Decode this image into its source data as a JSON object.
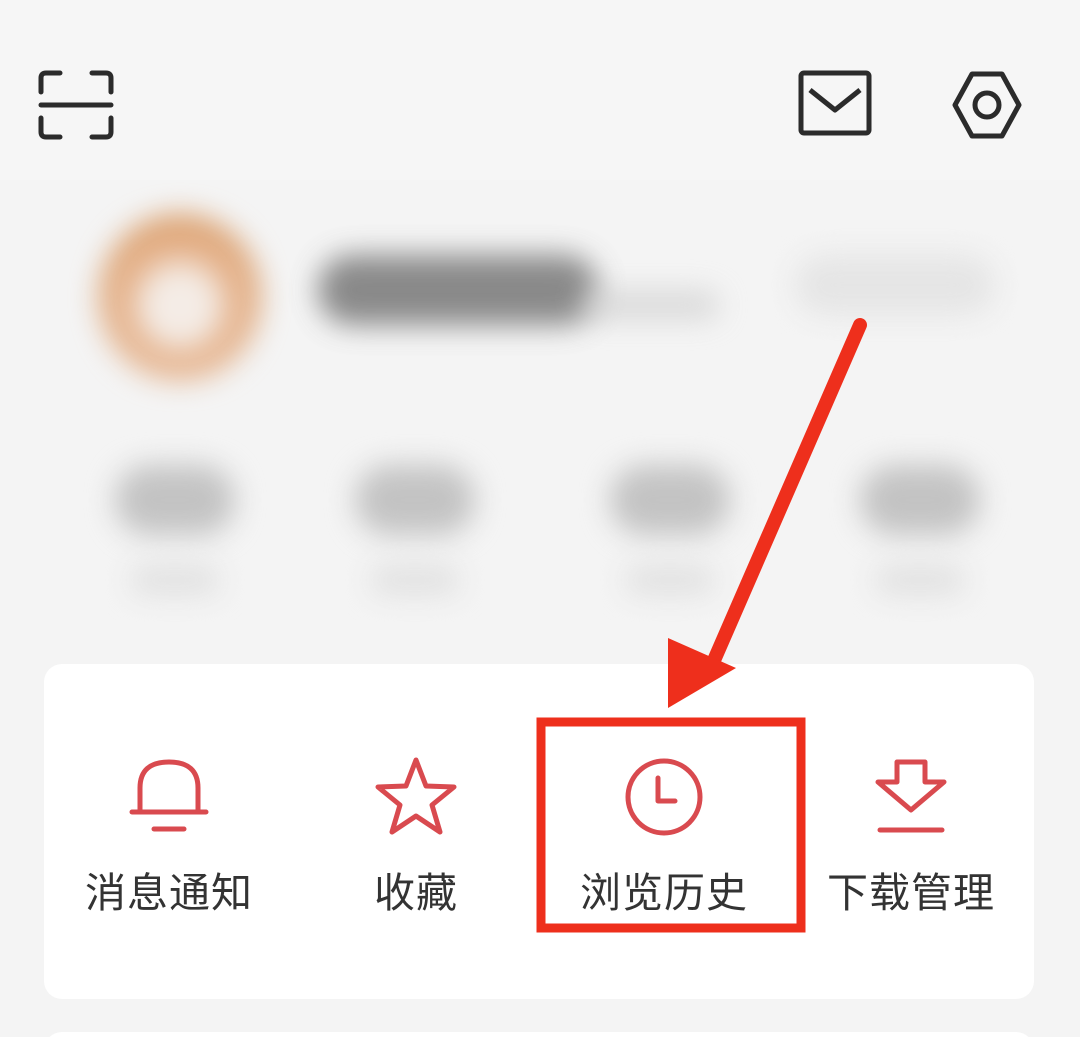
{
  "header": {
    "scan_icon": "scan-icon",
    "mail_icon": "mail-icon",
    "settings_icon": "gear-icon"
  },
  "quick_actions": [
    {
      "label": "消息通知",
      "icon": "bell-icon"
    },
    {
      "label": "收藏",
      "icon": "star-icon"
    },
    {
      "label": "浏览历史",
      "icon": "clock-icon"
    },
    {
      "label": "下载管理",
      "icon": "download-icon"
    }
  ],
  "annotation": {
    "highlighted_item": "浏览历史",
    "color": "#ee2f1c"
  },
  "colors": {
    "accent": "#d94a4f",
    "icon_dark": "#2b2b2b",
    "text": "#333333",
    "card_bg": "#ffffff",
    "page_bg": "#f4f4f4"
  }
}
